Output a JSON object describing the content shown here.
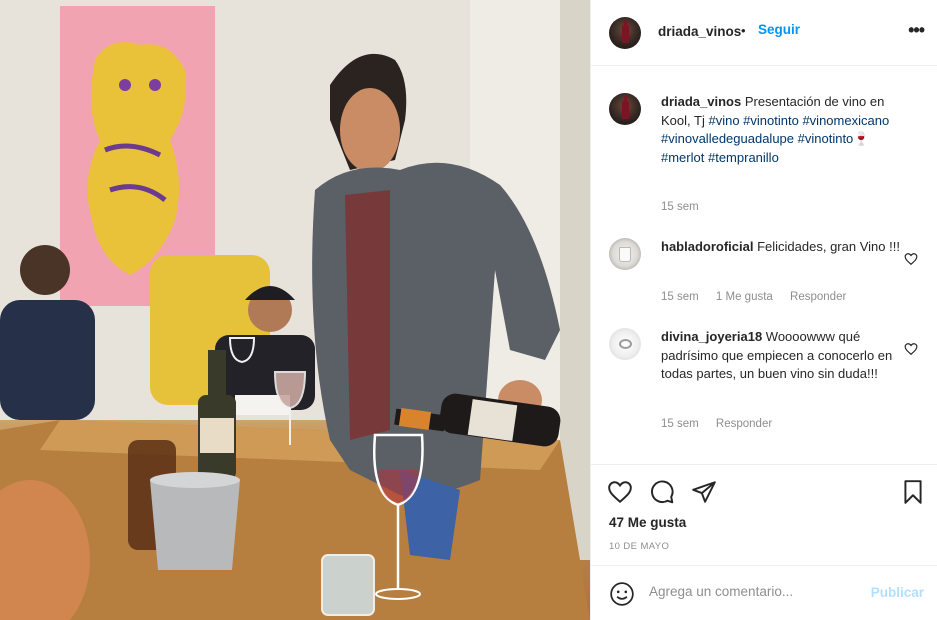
{
  "post": {
    "username": "driada_vinos",
    "separator": "•",
    "follow_label": "Seguir",
    "more_icon": "more-dots-icon"
  },
  "caption": {
    "username": "driada_vinos",
    "text": "Presentación de vino en Kool, Tj",
    "hashtags": [
      "#vino",
      "#vinotinto",
      "#vinomexicano",
      "#vinovalledeguadalupe",
      "#vinotinto",
      "#merlot",
      "#tempranillo"
    ],
    "wine_emoji": "🍷",
    "time": "15 sem"
  },
  "comments": [
    {
      "username": "habladoroficial",
      "text": "Felicidades, gran Vino !!!",
      "time": "15 sem",
      "likes": "1 Me gusta",
      "reply_label": "Responder"
    },
    {
      "username": "divina_joyeria18",
      "text": "Woooowww qué padrísimo que empiecen a conocerlo en todas partes, un buen vino sin duda!!!",
      "time": "15 sem",
      "reply_label": "Responder"
    }
  ],
  "actions": {
    "icons": [
      "heart-icon",
      "comment-icon",
      "share-icon",
      "bookmark-icon"
    ],
    "likes_count": "47 Me gusta",
    "date": "10 DE MAYO"
  },
  "add_comment": {
    "placeholder": "Agrega un comentario...",
    "publish_label": "Publicar",
    "emoji_icon": "emoji-icon"
  },
  "colors": {
    "accent": "#0095f6",
    "hashtag": "#00376b",
    "muted": "#8e8e8e",
    "publish_disabled": "#b2dffc"
  }
}
